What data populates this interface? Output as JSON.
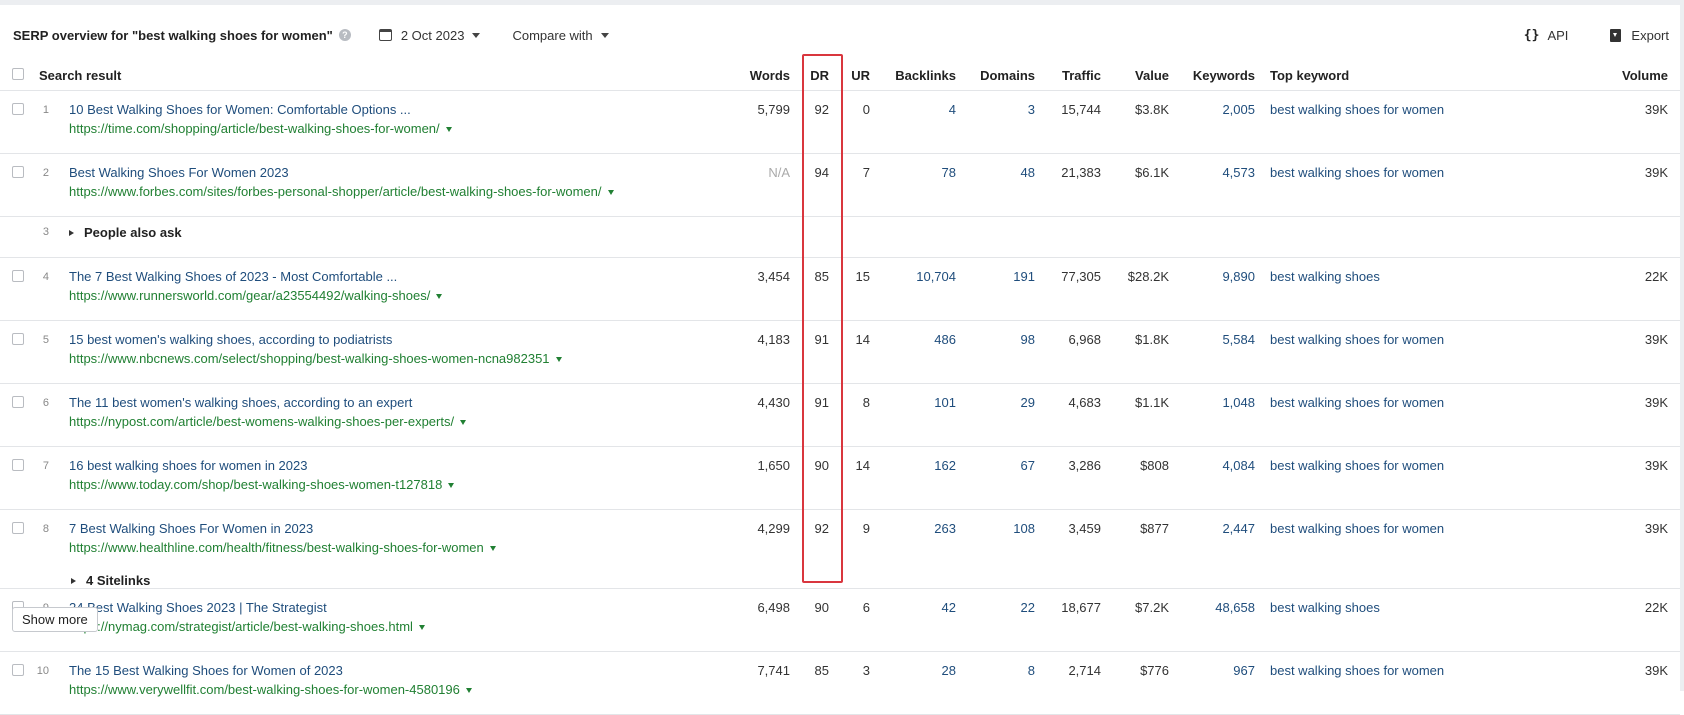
{
  "header": {
    "title": "SERP overview for \"best walking shoes for women\"",
    "date": "2 Oct 2023",
    "compare_label": "Compare with",
    "api_label": "API",
    "export_label": "Export"
  },
  "columns": {
    "search_result": "Search result",
    "words": "Words",
    "dr": "DR",
    "ur": "UR",
    "backlinks": "Backlinks",
    "domains": "Domains",
    "traffic": "Traffic",
    "value": "Value",
    "keywords": "Keywords",
    "top_keyword": "Top keyword",
    "volume": "Volume"
  },
  "results": [
    {
      "pos": "1",
      "title": "10 Best Walking Shoes for Women: Comfortable Options ...",
      "url": "https://time.com/shopping/article/best-walking-shoes-for-women/",
      "words": "5,799",
      "dr": "92",
      "ur": "0",
      "backlinks": "4",
      "domains": "3",
      "traffic": "15,744",
      "value": "$3.8K",
      "keywords": "2,005",
      "top_keyword": "best walking shoes for women",
      "volume": "39K"
    },
    {
      "pos": "2",
      "title": "Best Walking Shoes For Women 2023",
      "url": "https://www.forbes.com/sites/forbes-personal-shopper/article/best-walking-shoes-for-women/",
      "words": "N/A",
      "dr": "94",
      "ur": "7",
      "backlinks": "78",
      "domains": "48",
      "traffic": "21,383",
      "value": "$6.1K",
      "keywords": "4,573",
      "top_keyword": "best walking shoes for women",
      "volume": "39K"
    },
    {
      "pos": "4",
      "title": "The 7 Best Walking Shoes of 2023 - Most Comfortable ...",
      "url": "https://www.runnersworld.com/gear/a23554492/walking-shoes/",
      "words": "3,454",
      "dr": "85",
      "ur": "15",
      "backlinks": "10,704",
      "domains": "191",
      "traffic": "77,305",
      "value": "$28.2K",
      "keywords": "9,890",
      "top_keyword": "best walking shoes",
      "volume": "22K"
    },
    {
      "pos": "5",
      "title": "15 best women's walking shoes, according to podiatrists",
      "url": "https://www.nbcnews.com/select/shopping/best-walking-shoes-women-ncna982351",
      "words": "4,183",
      "dr": "91",
      "ur": "14",
      "backlinks": "486",
      "domains": "98",
      "traffic": "6,968",
      "value": "$1.8K",
      "keywords": "5,584",
      "top_keyword": "best walking shoes for women",
      "volume": "39K"
    },
    {
      "pos": "6",
      "title": "The 11 best women's walking shoes, according to an expert",
      "url": "https://nypost.com/article/best-womens-walking-shoes-per-experts/",
      "words": "4,430",
      "dr": "91",
      "ur": "8",
      "backlinks": "101",
      "domains": "29",
      "traffic": "4,683",
      "value": "$1.1K",
      "keywords": "1,048",
      "top_keyword": "best walking shoes for women",
      "volume": "39K"
    },
    {
      "pos": "7",
      "title": "16 best walking shoes for women in 2023",
      "url": "https://www.today.com/shop/best-walking-shoes-women-t127818",
      "words": "1,650",
      "dr": "90",
      "ur": "14",
      "backlinks": "162",
      "domains": "67",
      "traffic": "3,286",
      "value": "$808",
      "keywords": "4,084",
      "top_keyword": "best walking shoes for women",
      "volume": "39K"
    },
    {
      "pos": "8",
      "title": "7 Best Walking Shoes For Women in 2023",
      "url": "https://www.healthline.com/health/fitness/best-walking-shoes-for-women",
      "words": "4,299",
      "dr": "92",
      "ur": "9",
      "backlinks": "263",
      "domains": "108",
      "traffic": "3,459",
      "value": "$877",
      "keywords": "2,447",
      "top_keyword": "best walking shoes for women",
      "volume": "39K",
      "sitelinks": "4 Sitelinks"
    },
    {
      "pos": "9",
      "title": "24 Best Walking Shoes 2023 | The Strategist",
      "url": "https://nymag.com/strategist/article/best-walking-shoes.html",
      "words": "6,498",
      "dr": "90",
      "ur": "6",
      "backlinks": "42",
      "domains": "22",
      "traffic": "18,677",
      "value": "$7.2K",
      "keywords": "48,658",
      "top_keyword": "best walking shoes",
      "volume": "22K"
    },
    {
      "pos": "10",
      "title": "The 15 Best Walking Shoes for Women of 2023",
      "url": "https://www.verywellfit.com/best-walking-shoes-for-women-4580196",
      "words": "7,741",
      "dr": "85",
      "ur": "3",
      "backlinks": "28",
      "domains": "8",
      "traffic": "2,714",
      "value": "$776",
      "keywords": "967",
      "top_keyword": "best walking shoes for women",
      "volume": "39K"
    }
  ],
  "people_also_ask": {
    "pos": "3",
    "label": "People also ask"
  },
  "show_more_label": "Show more",
  "colors": {
    "highlight": "#d9363e",
    "link": "#1f4d7c",
    "url": "#218033"
  }
}
